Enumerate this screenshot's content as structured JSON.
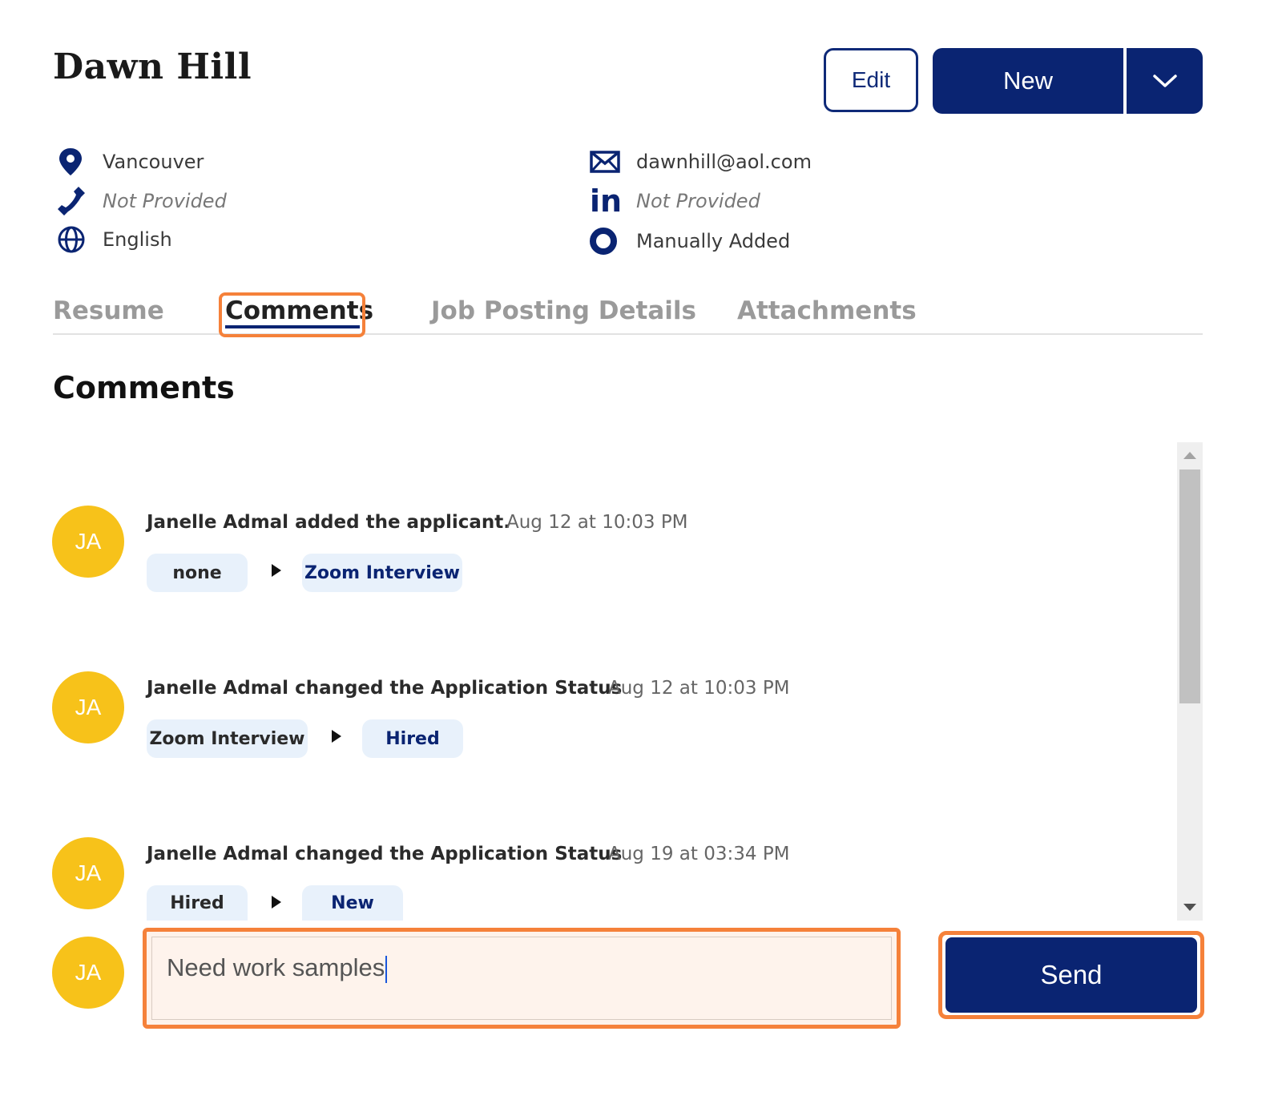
{
  "candidate": {
    "name": "Dawn Hill"
  },
  "actions": {
    "edit_label": "Edit",
    "new_label": "New"
  },
  "info": {
    "location": "Vancouver",
    "phone": "Not Provided",
    "language": "English",
    "email": "dawnhill@aol.com",
    "linkedin": "Not Provided",
    "source": "Manually Added"
  },
  "tabs": [
    {
      "label": "Resume"
    },
    {
      "label": "Comments"
    },
    {
      "label": "Job Posting Details"
    },
    {
      "label": "Attachments"
    }
  ],
  "active_tab": "Comments",
  "section_title": "Comments",
  "entries": [
    {
      "initials": "JA",
      "text": "Janelle Admal added the applicant.",
      "time": "Aug 12 at 10:03 PM",
      "from": "none",
      "to": "Zoom Interview"
    },
    {
      "initials": "JA",
      "text": "Janelle Admal changed the Application Status",
      "time": "Aug 12 at 10:03 PM",
      "from": "Zoom Interview",
      "to": "Hired"
    },
    {
      "initials": "JA",
      "text": "Janelle Admal changed the Application Status",
      "time": "Aug 19 at 03:34 PM",
      "from": "Hired",
      "to": "New"
    }
  ],
  "composer": {
    "initials": "JA",
    "value": "Need work samples",
    "send_label": "Send"
  },
  "colors": {
    "primary": "#0a2472",
    "avatar": "#f7c21a",
    "highlight": "#f5813a",
    "chip_bg": "#e8f1fb"
  },
  "icons": {
    "location": "map-pin-icon",
    "phone": "phone-icon",
    "language": "globe-icon",
    "email": "envelope-icon",
    "linkedin": "linkedin-icon",
    "source": "ring-icon",
    "dropdown": "chevron-down-icon"
  }
}
